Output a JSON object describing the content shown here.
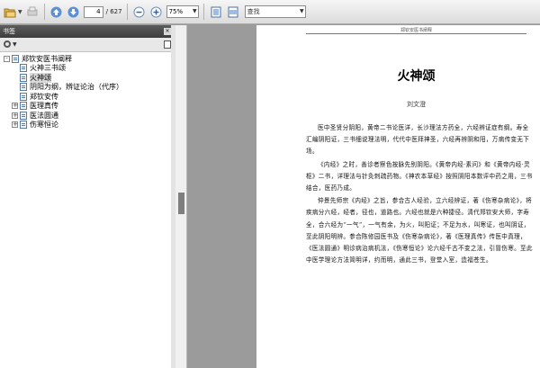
{
  "toolbar": {
    "current_page": "4",
    "page_total": "/ 627",
    "zoom": "75%",
    "search_placeholder": "查找"
  },
  "bookmarks": {
    "panel_title": "书签",
    "close_glyph": "×",
    "items": [
      {
        "label": "郑钦安医书阐释",
        "toggle": "-"
      },
      {
        "label": "火神三书颂",
        "toggle": ""
      },
      {
        "label": "火神颂",
        "toggle": ""
      },
      {
        "label": "阴阳为纲，辨证论治（代序）",
        "toggle": ""
      },
      {
        "label": "郑钦安传",
        "toggle": ""
      },
      {
        "label": "医理真传",
        "toggle": "+"
      },
      {
        "label": "医法圆通",
        "toggle": "+"
      },
      {
        "label": "伤寒恒论",
        "toggle": "+"
      }
    ]
  },
  "page": {
    "running_head": "郑钦安医书阐释",
    "title": "火神颂",
    "author": "刘文澄",
    "paragraphs": [
      "医中圣贤分阴阳，黄帝二书论医详，长沙理法方药全，六经辨证症有纲。寿全汇编阴阳证，三书细说理法明，代代中医拜神圣，六经再辨阴和阳，万病传变无下场。",
      "《内经》之时，善诊者察色按脉先别阴阳。《黄帝内经·素问》和《黄帝内经·灵枢》二书，详理法与针灸刺疏药物。《神农本草经》按照阴阳本数评中药之用，三书结合，医药乃成。",
      "仲景先师宗《内经》之旨，参合古人经验，立六经辨证，著《伤寒杂病论》，将疾病分六经，经者，径也，道路也。六经也就是六种捷径。清代郑钦安大师，字寿全，合六经为“一气”，一气有余，为火，叫阳证；不足为水，叫寒证，也叫阴证，至此阴阳明辨。参合陈修园医书及《伤寒杂病论》，著《医理真传》传医中真理，《医法圆通》明诊病治病机法，《伤寒恒论》论六经千古不变之法，引冒伤寒。至此中医学理论方法简明详，约而明，通此三书，登堂入室，造福苍生。"
    ]
  }
}
